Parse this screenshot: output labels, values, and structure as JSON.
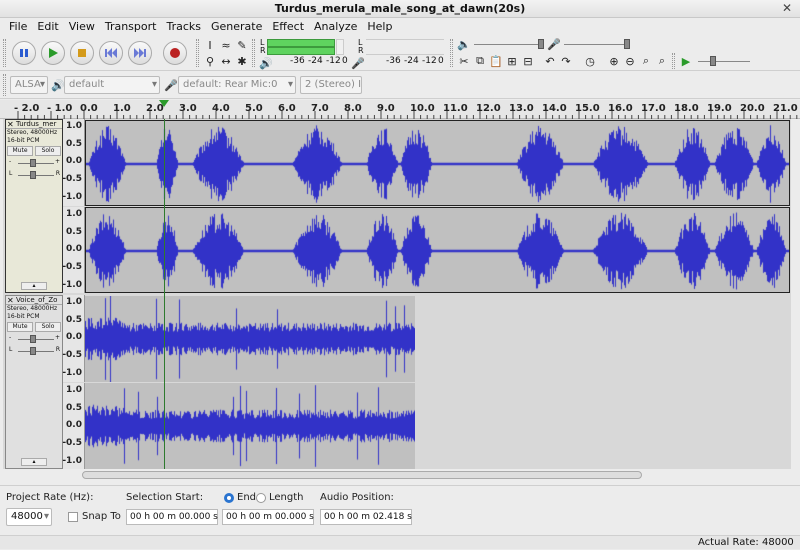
{
  "window": {
    "title": "Turdus_merula_male_song_at_dawn(20s)",
    "close_glyph": "✕"
  },
  "menu": [
    "File",
    "Edit",
    "View",
    "Transport",
    "Tracks",
    "Generate",
    "Effect",
    "Analyze",
    "Help"
  ],
  "meters": {
    "playback_labels": [
      "L",
      "R"
    ],
    "record_labels": [
      "L",
      "R"
    ],
    "scale_play": [
      "-36",
      "-24",
      "-12",
      "0"
    ],
    "scale_rec": [
      "-36",
      "-24",
      "-12",
      "0"
    ]
  },
  "device_toolbar": {
    "host": "ALSA",
    "output": "default",
    "input": "default: Rear Mic:0",
    "channels": "2 (Stereo) I"
  },
  "ruler": {
    "labels": [
      "- 2.0",
      "- 1.0",
      "0.0",
      "1.0",
      "2.0",
      "3.0",
      "4.0",
      "5.0",
      "6.0",
      "7.0",
      "8.0",
      "9.0",
      "10.0",
      "11.0",
      "12.0",
      "13.0",
      "14.0",
      "15.0",
      "16.0",
      "17.0",
      "18.0",
      "19.0",
      "20.0",
      "21.0"
    ],
    "playhead_seconds": 2.418
  },
  "tracks": [
    {
      "name": "Turdus_mer",
      "info": [
        "Stereo, 48000Hz",
        "16-bit PCM"
      ],
      "mute": "Mute",
      "solo": "Solo",
      "gain_labels": [
        "-",
        "+"
      ],
      "pan_labels": [
        "L",
        "R"
      ],
      "vruler": [
        "1.0",
        "0.5",
        "0.0",
        "-0.5",
        "-1.0"
      ]
    },
    {
      "name": "Voice_of_Zo",
      "info": [
        "Stereo, 48000Hz",
        "16-bit PCM"
      ],
      "mute": "Mute",
      "solo": "Solo",
      "gain_labels": [
        "-",
        "+"
      ],
      "pan_labels": [
        "L",
        "R"
      ],
      "vruler": [
        "1.0",
        "0.5",
        "0.0",
        "-0.5",
        "-1.0"
      ]
    }
  ],
  "bottom": {
    "project_rate_label": "Project Rate (Hz):",
    "project_rate": "48000",
    "snap_to": "Snap To",
    "selection_start_label": "Selection Start:",
    "end_label": "End",
    "length_label": "Length",
    "audio_position_label": "Audio Position:",
    "sel_start": "00 h 00 m 00.000 s",
    "sel_end": "00 h 00 m 00.000 s",
    "audio_position": "00 h 00 m 02.418 s"
  },
  "status": {
    "actual_rate": "Actual Rate: 48000"
  },
  "colors": {
    "waveform": "#3232c8",
    "accent": "#2a74d0"
  }
}
